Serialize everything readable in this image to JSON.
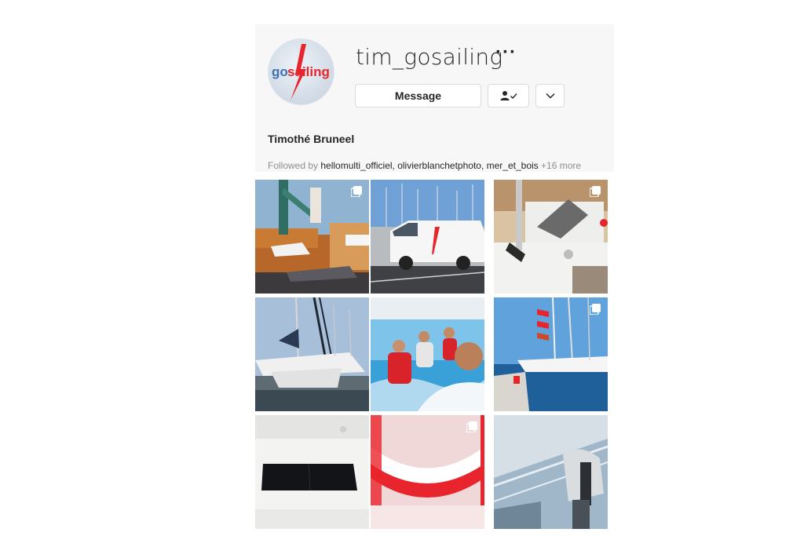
{
  "profile": {
    "username": "tim_gosailing",
    "avatar_logo_text": "gosailing",
    "full_name": "Timothé Bruneel",
    "more_icon": "more-horizontal-icon",
    "buttons": {
      "message": "Message",
      "following_icon": "person-check-icon",
      "dropdown_icon": "chevron-down-icon"
    },
    "followed_by": {
      "prefix": "Followed by ",
      "accounts": [
        "hellomulti_officiel",
        "olivierblanchetphoto",
        "mer_et_bois"
      ],
      "more": "+16 more"
    }
  },
  "posts": [
    {
      "subject": "crane lifting catamaran at harbour",
      "multi": true
    },
    {
      "subject": "white gosailing van in marina parking",
      "multi": false
    },
    {
      "subject": "winch and cleat on deck",
      "multi": true
    },
    {
      "subject": "catamaran moored in marina",
      "multi": false
    },
    {
      "subject": "crew selfie on boat",
      "multi": false
    },
    {
      "subject": "catamaran at pontoon with flags",
      "multi": true
    },
    {
      "subject": "black glass induction cooktop",
      "multi": false
    },
    {
      "subject": "red and white hull detail",
      "multi": true
    },
    {
      "subject": "outboard motor on stern",
      "multi": false
    }
  ],
  "colors": {
    "brand_red": "#e8242c",
    "logo_blue": "#3f6fb3",
    "text": "#262626",
    "muted": "#8e8e8e"
  }
}
